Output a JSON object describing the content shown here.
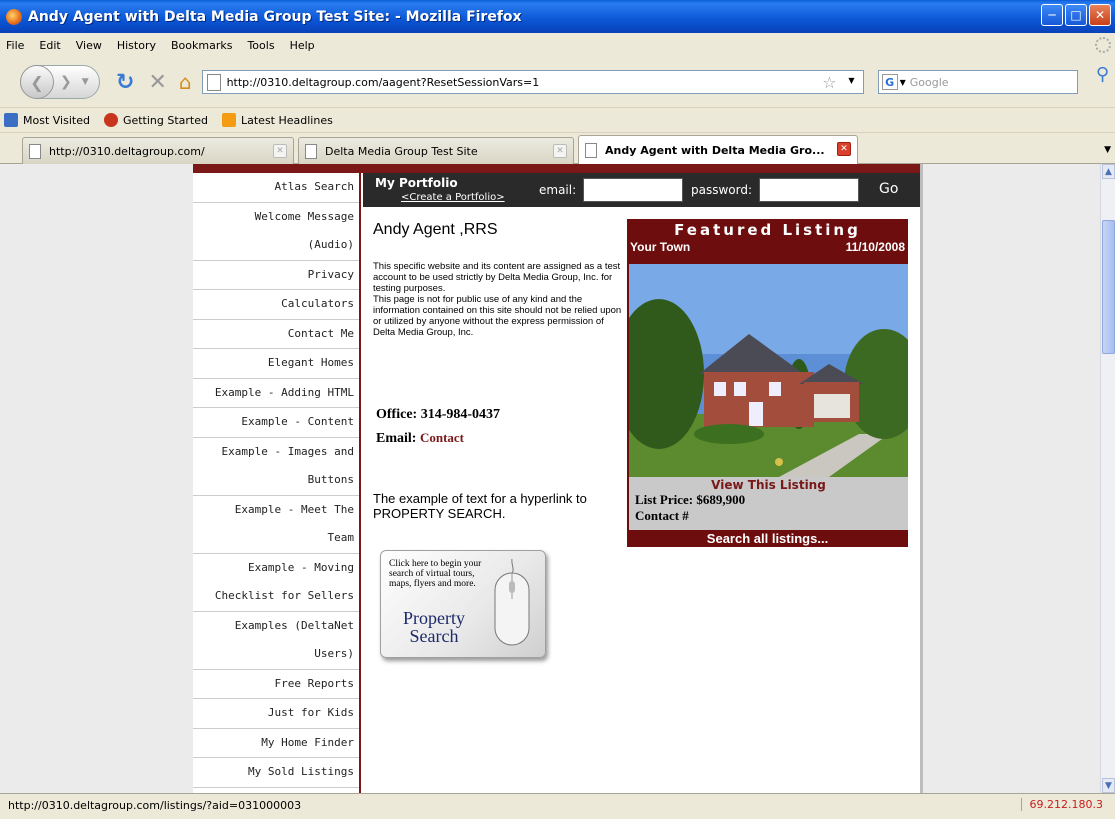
{
  "window": {
    "title": "Andy Agent with Delta Media Group Test Site: - Mozilla Firefox"
  },
  "menu": [
    "File",
    "Edit",
    "View",
    "History",
    "Bookmarks",
    "Tools",
    "Help"
  ],
  "nav": {
    "url": "http://0310.deltagroup.com/aagent?ResetSessionVars=1",
    "search_placeholder": "Google"
  },
  "bookmarks": [
    "Most Visited",
    "Getting Started",
    "Latest Headlines"
  ],
  "tabs": [
    {
      "label": "http://0310.deltagroup.com/",
      "active": false
    },
    {
      "label": "Delta Media Group Test Site",
      "active": false
    },
    {
      "label": "Andy Agent with Delta Media Gro...",
      "active": true
    }
  ],
  "sidebar": {
    "items": [
      "Atlas Search",
      "Welcome Message",
      "(Audio)",
      "Privacy",
      "Calculators",
      "Contact Me",
      "Elegant Homes",
      "Example - Adding HTML",
      "Example - Content",
      "Example - Images and",
      "Buttons",
      "Example - Meet The",
      "Team",
      "Example - Moving",
      "Checklist for Sellers",
      "Examples (DeltaNet",
      "Users)",
      "Free Reports",
      "Just for Kids",
      "My Home Finder",
      "My Sold Listings"
    ]
  },
  "portfolio": {
    "title": "My Portfolio",
    "create_link": "<Create a Portfolio>",
    "email_label": "email:",
    "password_label": "password:",
    "go_label": "Go"
  },
  "agent": {
    "name": "Andy Agent ,RRS",
    "description": "This specific website and its content are assigned as a test account to be used strictly by Delta Media Group, Inc. for testing purposes.\nThis page is not for public use of any kind and the information contained on this site should not be relied upon or utilized by anyone without the express permission of Delta Media Group, Inc.",
    "office": "Office: 314-984-0437",
    "email_label": "Email:",
    "email_link": "Contact",
    "hyperlink_text": "The example of text for a hyperlink to PROPERTY SEARCH."
  },
  "property_button": {
    "small_text": "Click here to begin your search of virtual tours, maps, flyers and more.",
    "big_text": "Property Search"
  },
  "featured": {
    "header": "Featured Listing",
    "town": "Your Town",
    "date": "11/10/2008",
    "view_link": "View This Listing",
    "list_price": "List Price: $689,900",
    "contact": "Contact #",
    "search_all": "Search all listings..."
  },
  "status": {
    "text": "http://0310.deltagroup.com/listings/?aid=031000003",
    "ip": "69.212.180.3"
  },
  "colors": {
    "brand_maroon": "#6e0d0d",
    "titlebar_blue": "#0b56d6"
  }
}
